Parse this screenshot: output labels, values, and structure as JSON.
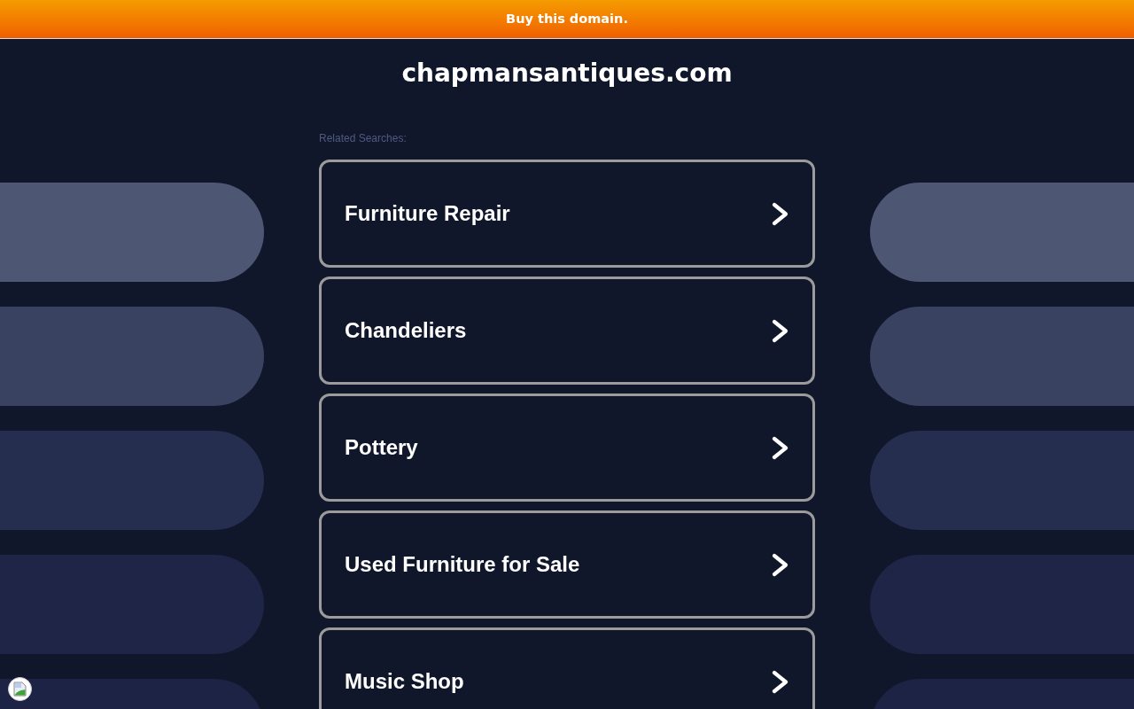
{
  "banner": {
    "link": "Buy this domain."
  },
  "title": "chapmansantiques.com",
  "related_searches": {
    "heading": "Related Searches:",
    "items": [
      {
        "label": "Furniture Repair"
      },
      {
        "label": "Chandeliers"
      },
      {
        "label": "Pottery"
      },
      {
        "label": "Used Furniture for Sale"
      },
      {
        "label": "Music Shop"
      }
    ]
  }
}
